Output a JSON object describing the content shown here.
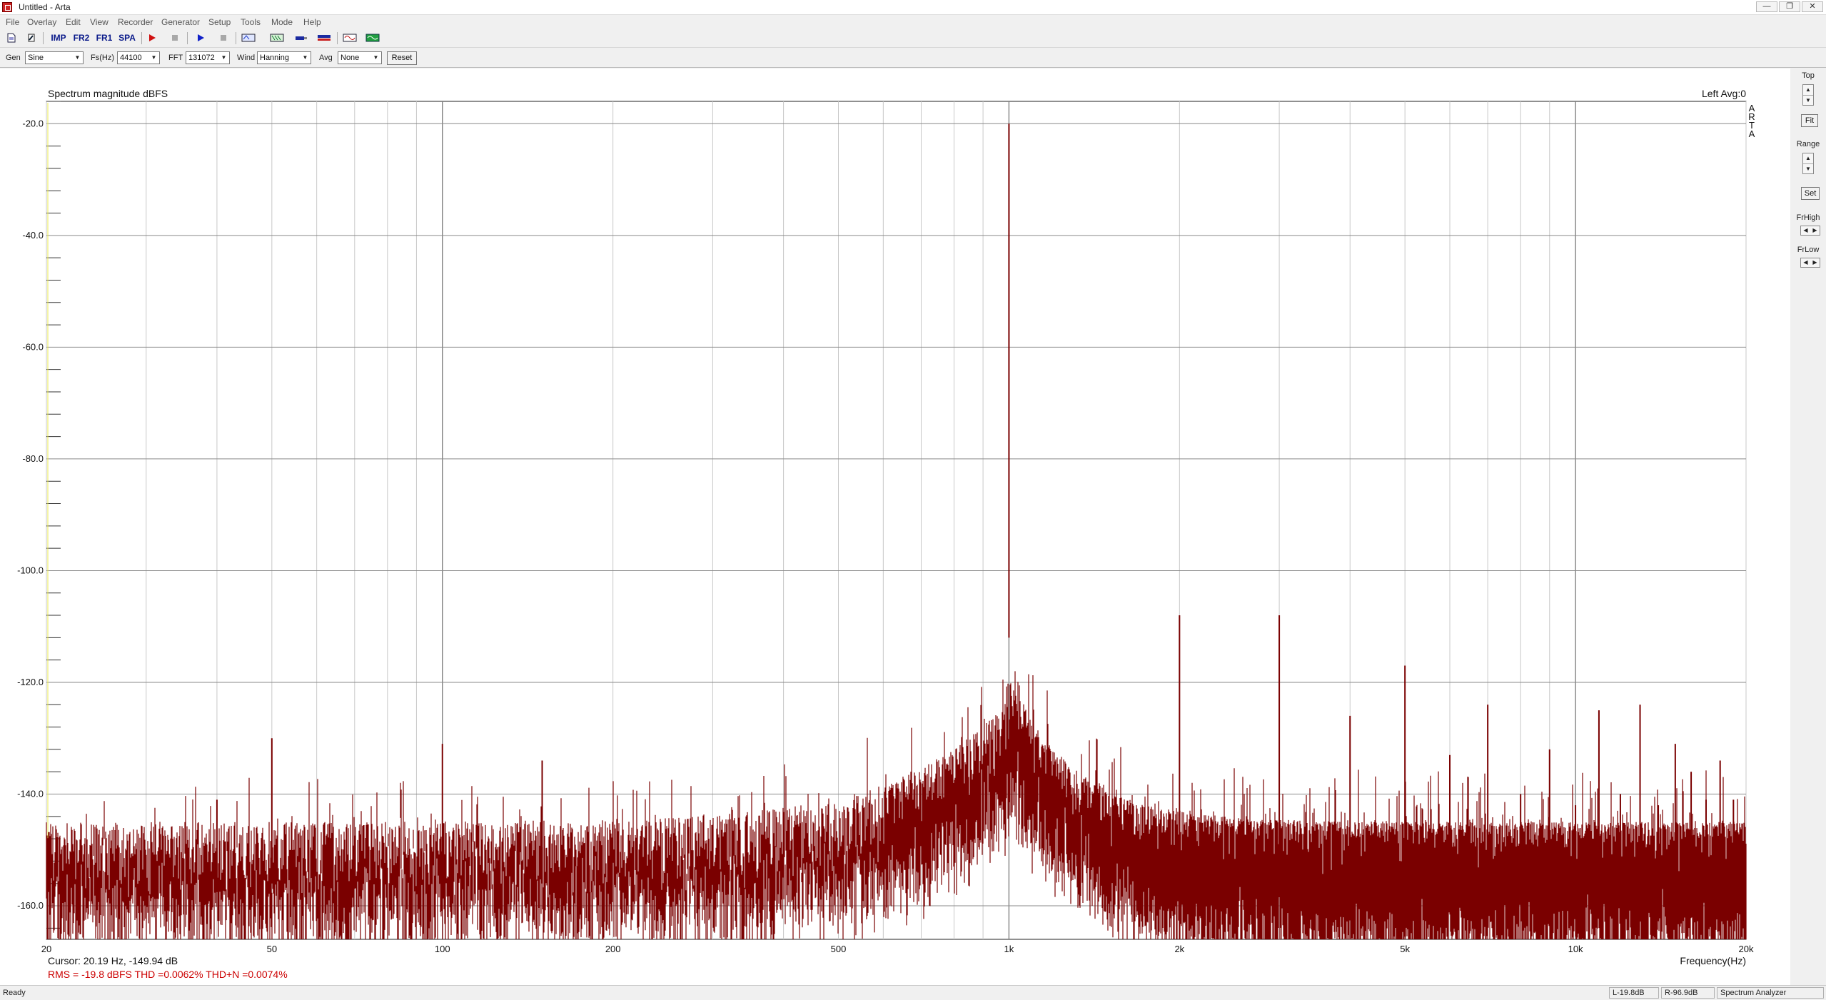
{
  "window": {
    "title": "Untitled - Arta",
    "controls": [
      "—",
      "❐",
      "✕"
    ]
  },
  "menu": [
    "File",
    "Overlay",
    "Edit",
    "View",
    "Recorder",
    "Generator",
    "Setup",
    "Tools",
    "Mode",
    "Help"
  ],
  "toolbar": {
    "buttons": [
      {
        "name": "new-document-icon",
        "label": ""
      },
      {
        "name": "open-icon",
        "label": ""
      },
      {
        "name": "impulse-mode-button",
        "label": "IMP"
      },
      {
        "name": "fr2-mode-button",
        "label": "FR2"
      },
      {
        "name": "fr1-mode-button",
        "label": "FR1"
      },
      {
        "name": "spa-mode-button",
        "label": "SPA"
      },
      {
        "name": "record-icon",
        "label": ""
      },
      {
        "name": "stop-icon",
        "label": ""
      },
      {
        "name": "play-icon",
        "label": ""
      },
      {
        "name": "stop2-icon",
        "label": ""
      },
      {
        "name": "rec-settings-icon",
        "label": ""
      },
      {
        "name": "analyzer-icon",
        "label": ""
      },
      {
        "name": "probe-icon",
        "label": ""
      },
      {
        "name": "level-meter-icon",
        "label": ""
      },
      {
        "name": "generator-icon",
        "label": ""
      },
      {
        "name": "scope-icon",
        "label": ""
      }
    ]
  },
  "controls": {
    "gen_label": "Gen",
    "gen_value": "Sine",
    "fs_label": "Fs(Hz)",
    "fs_value": "44100",
    "fft_label": "FFT",
    "fft_value": "131072",
    "wind_label": "Wind",
    "wind_value": "Hanning",
    "avg_label": "Avg",
    "avg_value": "None",
    "reset_label": "Reset"
  },
  "plot": {
    "title": "Spectrum magnitude dBFS",
    "channel_info": "Left  Avg:0",
    "watermark": [
      "A",
      "R",
      "T",
      "A"
    ],
    "xaxis_label": "Frequency(Hz)",
    "cursor_text": "Cursor: 20.19 Hz, -149.94 dB",
    "stats_text": "RMS =  -19.8 dBFS   THD =0.0062%   THD+N =0.0074%",
    "trace_color": "#7a0000",
    "stats_color": "#cc0000"
  },
  "chart_data": {
    "type": "line",
    "title": "Spectrum magnitude dBFS",
    "xlabel": "Frequency(Hz)",
    "ylabel": "",
    "xscale": "log",
    "xlim": [
      20,
      20000
    ],
    "ylim": [
      -166,
      -16
    ],
    "grid": true,
    "x_ticks": [
      {
        "v": 20,
        "label": "20"
      },
      {
        "v": 50,
        "label": "50"
      },
      {
        "v": 100,
        "label": "100"
      },
      {
        "v": 200,
        "label": "200"
      },
      {
        "v": 500,
        "label": "500"
      },
      {
        "v": 1000,
        "label": "1k"
      },
      {
        "v": 2000,
        "label": "2k"
      },
      {
        "v": 5000,
        "label": "5k"
      },
      {
        "v": 10000,
        "label": "10k"
      },
      {
        "v": 20000,
        "label": "20k"
      }
    ],
    "y_ticks": [
      {
        "v": -20,
        "label": "-20.0"
      },
      {
        "v": -40,
        "label": "-40.0"
      },
      {
        "v": -60,
        "label": "-60.0"
      },
      {
        "v": -80,
        "label": "-80.0"
      },
      {
        "v": -100,
        "label": "-100.0"
      },
      {
        "v": -120,
        "label": "-120.0"
      },
      {
        "v": -140,
        "label": "-140.0"
      },
      {
        "v": -160,
        "label": "-160.0"
      }
    ],
    "fundamental": {
      "x": 1000,
      "y": -20
    },
    "noise_floor_dbfs": -152,
    "peaks": [
      {
        "x": 40,
        "y": -141
      },
      {
        "x": 50,
        "y": -130
      },
      {
        "x": 100,
        "y": -131
      },
      {
        "x": 150,
        "y": -134
      },
      {
        "x": 2000,
        "y": -108
      },
      {
        "x": 3000,
        "y": -108
      },
      {
        "x": 4000,
        "y": -126
      },
      {
        "x": 5000,
        "y": -117
      },
      {
        "x": 6000,
        "y": -133
      },
      {
        "x": 7000,
        "y": -124
      },
      {
        "x": 8000,
        "y": -140
      },
      {
        "x": 9000,
        "y": -132
      },
      {
        "x": 10000,
        "y": -142
      },
      {
        "x": 11000,
        "y": -125
      },
      {
        "x": 12000,
        "y": -140
      },
      {
        "x": 13000,
        "y": -124
      },
      {
        "x": 14000,
        "y": -142
      },
      {
        "x": 15000,
        "y": -131
      },
      {
        "x": 16000,
        "y": -136
      },
      {
        "x": 17000,
        "y": -141
      },
      {
        "x": 18000,
        "y": -134
      },
      {
        "x": 19000,
        "y": -141
      }
    ]
  },
  "right_panel": {
    "top_label": "Top",
    "fit_label": "Fit",
    "range_label": "Range",
    "set_label": "Set",
    "frhigh_label": "FrHigh",
    "frlow_label": "FrLow"
  },
  "status": {
    "ready": "Ready",
    "left_level": "L-19.8dB",
    "right_level": "R-96.9dB",
    "mode": "Spectrum Analyzer"
  }
}
